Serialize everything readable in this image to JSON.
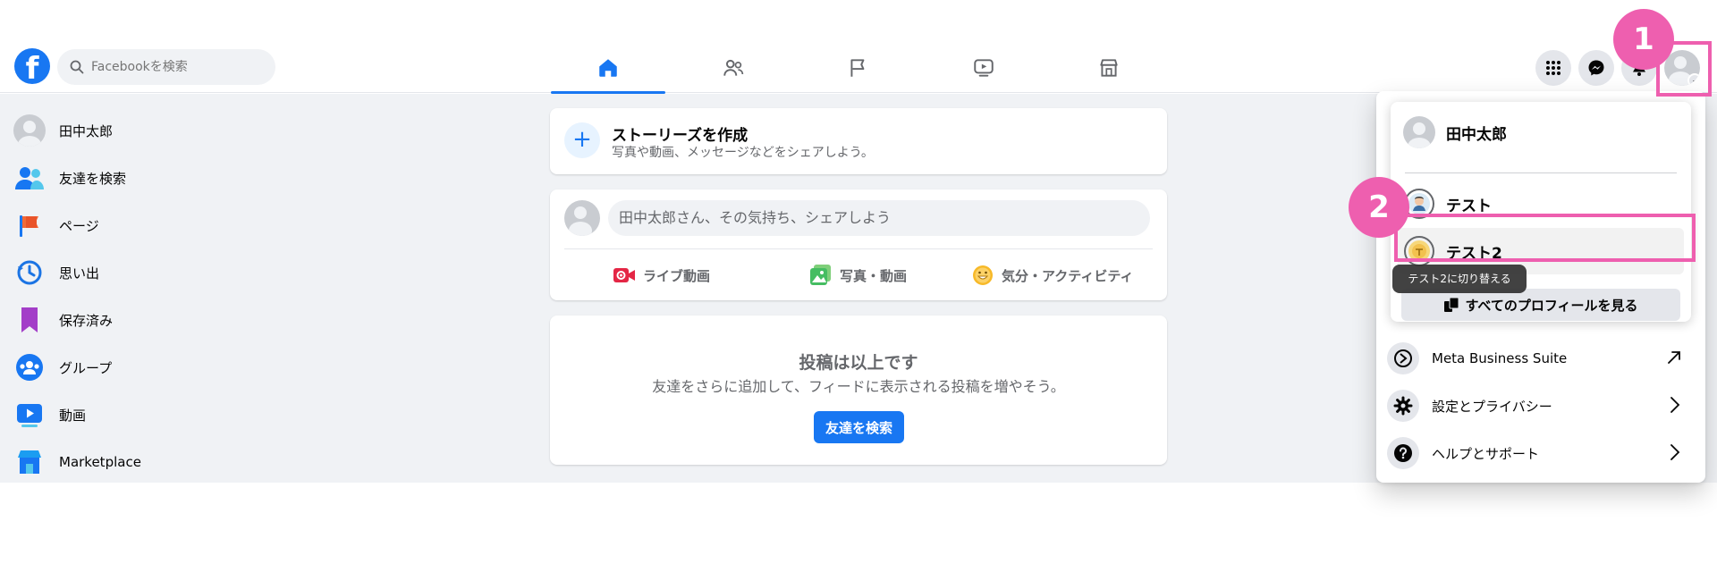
{
  "search": {
    "placeholder": "Facebookを検索"
  },
  "nav": {
    "tabs": [
      "home",
      "friends",
      "pages",
      "watch",
      "marketplace"
    ]
  },
  "header_icons": [
    "menu-grid-icon",
    "messenger-icon",
    "notifications-icon"
  ],
  "sidebar": {
    "items": [
      {
        "label": "田中太郎",
        "icon": "avatar"
      },
      {
        "label": "友達を検索",
        "icon": "friends-icon"
      },
      {
        "label": "ページ",
        "icon": "flag-icon"
      },
      {
        "label": "思い出",
        "icon": "memories-icon"
      },
      {
        "label": "保存済み",
        "icon": "bookmark-icon"
      },
      {
        "label": "グループ",
        "icon": "groups-icon"
      },
      {
        "label": "動画",
        "icon": "video-icon"
      },
      {
        "label": "Marketplace",
        "icon": "store-icon"
      }
    ]
  },
  "story": {
    "title": "ストーリーズを作成",
    "subtitle": "写真や動画、メッセージなどをシェアしよう。"
  },
  "composer": {
    "placeholder": "田中太郎さん、その気持ち、シェアしよう",
    "actions": [
      "ライブ動画",
      "写真・動画",
      "気分・アクティビティ"
    ]
  },
  "feed_empty": {
    "title": "投稿は以上です",
    "subtitle": "友達をさらに追加して、フィードに表示される投稿を増やそう。",
    "button": "友達を検索"
  },
  "menu": {
    "profiles": [
      "田中太郎",
      "テスト",
      "テスト2"
    ],
    "all_profiles_button": "すべてのプロフィールを見る",
    "tooltip": "テスト2に切り替える",
    "items": [
      {
        "label": "Meta Business Suite",
        "icon": "meta-business-icon",
        "arrow": "external-link-icon"
      },
      {
        "label": "設定とプライバシー",
        "icon": "gear-icon",
        "arrow": "chevron-right-icon"
      },
      {
        "label": "ヘルプとサポート",
        "icon": "help-icon",
        "arrow": "chevron-right-icon"
      }
    ]
  },
  "annotations": [
    "1",
    "2"
  ],
  "colors": {
    "brand": "#1877f2",
    "annotation": "#ee5faf",
    "background": "#f0f2f5"
  }
}
